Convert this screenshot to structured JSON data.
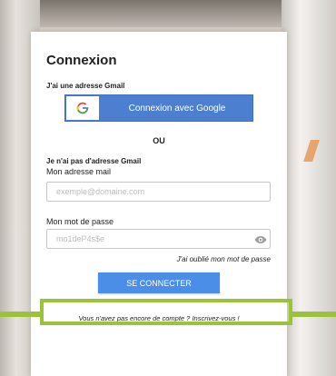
{
  "login": {
    "title": "Connexion",
    "gmail_prompt": "J'ai une adresse Gmail",
    "google_button_label": "Connexion avec Google",
    "google_icon_letter": "G",
    "separator": "OU",
    "no_gmail_prompt": "Je n'ai pas d'adresse Gmail",
    "email_label": "Mon adresse mail",
    "email_placeholder": "exemple@domaine.com",
    "password_label": "Mon mot de passe",
    "password_placeholder": "mo1deP4s$e",
    "forgot_password": "J'ai oublié mon mot de passe",
    "submit_label": "SE CONNECTER",
    "signup_text": "Vous n'avez pas encore de compte ? ",
    "signup_link": "Inscrivez-vous",
    "signup_suffix": " !"
  },
  "icons": {
    "google": "google-icon",
    "eye": "eye-icon"
  },
  "colors": {
    "google_button": "#4d7fd1",
    "submit_button": "#4a8ee8",
    "highlight": "#9cc13a"
  }
}
